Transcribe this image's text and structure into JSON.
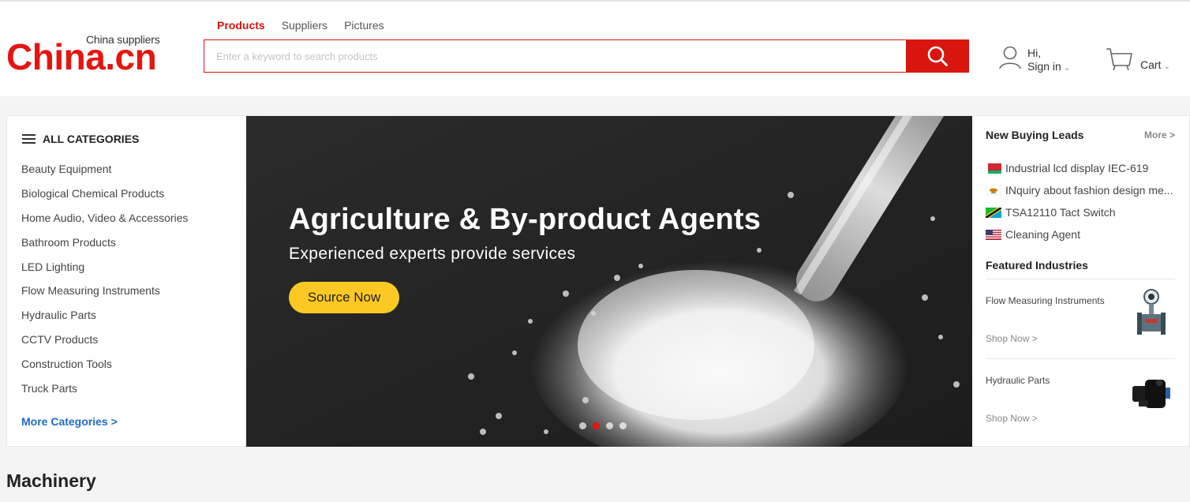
{
  "logo": {
    "main": "China.cn",
    "sub": "China suppliers"
  },
  "search": {
    "tabs": [
      {
        "label": "Products",
        "active": true
      },
      {
        "label": "Suppliers",
        "active": false
      },
      {
        "label": "Pictures",
        "active": false
      }
    ],
    "placeholder": "Enter a keyword to search products",
    "value": ""
  },
  "user": {
    "greeting": "Hi,",
    "signin_label": "Sign in"
  },
  "cart": {
    "label": "Cart"
  },
  "categories": {
    "title": "ALL CATEGORIES",
    "items": [
      "Beauty Equipment",
      "Biological Chemical Products",
      "Home Audio, Video & Accessories",
      "Bathroom Products",
      "LED Lighting",
      "Flow Measuring Instruments",
      "Hydraulic Parts",
      "CCTV Products",
      "Construction Tools",
      "Truck Parts"
    ],
    "more_label": "More Categories >"
  },
  "banner": {
    "title": "Agriculture & By-product Agents",
    "subtitle": "Experienced experts provide services",
    "cta_label": "Source Now",
    "slides": 4,
    "active_slide": 1
  },
  "buying_leads": {
    "title": "New Buying Leads",
    "more_label": "More >",
    "items": [
      {
        "text": "Industrial lcd display IEC-619",
        "flag": "belarus-flag-icon"
      },
      {
        "text": "INquiry about fashion design me...",
        "flag": "cyprus-flag-icon"
      },
      {
        "text": "TSA12110 Tact Switch",
        "flag": "tanzania-flag-icon"
      },
      {
        "text": "Cleaning Agent",
        "flag": "usa-flag-icon"
      }
    ]
  },
  "featured": {
    "title": "Featured Industries",
    "items": [
      {
        "name": "Flow Measuring Instruments",
        "shop_label": "Shop Now >",
        "image": "flow-meter-image"
      },
      {
        "name": "Hydraulic Parts",
        "shop_label": "Shop Now >",
        "image": "hydraulic-part-image"
      }
    ]
  },
  "section": {
    "title": "Machinery"
  },
  "colors": {
    "brand_red": "#e4160f",
    "cta_yellow": "#fcc924",
    "link_blue": "#1e6bc4"
  }
}
